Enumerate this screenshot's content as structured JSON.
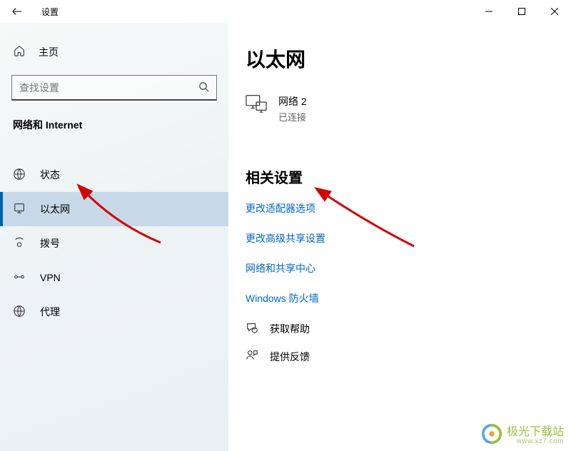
{
  "titlebar": {
    "title": "设置"
  },
  "sidebar": {
    "home": "主页",
    "search_placeholder": "查找设置",
    "section": "网络和 Internet",
    "items": [
      {
        "label": "状态"
      },
      {
        "label": "以太网"
      },
      {
        "label": "拨号"
      },
      {
        "label": "VPN"
      },
      {
        "label": "代理"
      }
    ],
    "selected_index": 1
  },
  "main": {
    "heading": "以太网",
    "network": {
      "name": "网络 2",
      "status": "已连接"
    },
    "related_heading": "相关设置",
    "links": [
      "更改适配器选项",
      "更改高级共享设置",
      "网络和共享中心",
      "Windows 防火墙"
    ],
    "help": "获取帮助",
    "feedback": "提供反馈"
  },
  "watermark": {
    "text": "极光下载站",
    "url": "www.xz7.com"
  }
}
